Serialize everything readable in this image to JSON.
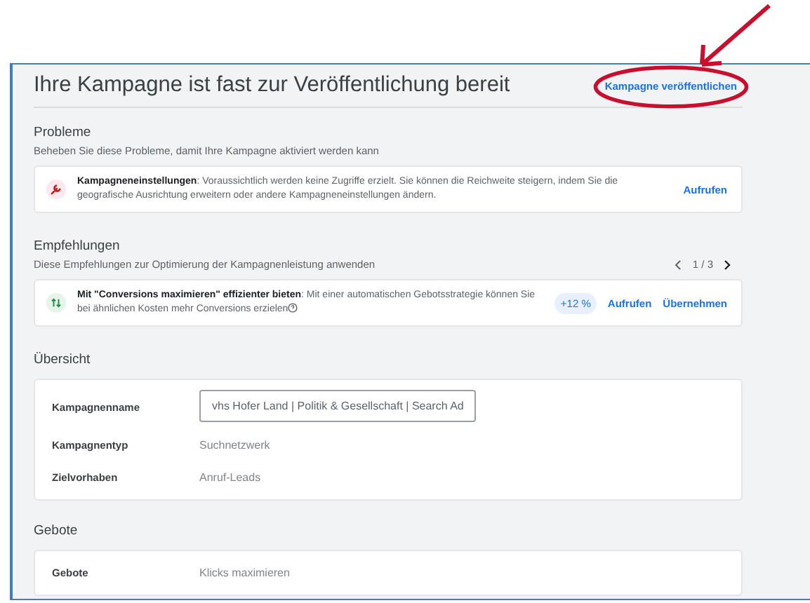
{
  "header": {
    "title": "Ihre Kampagne ist fast zur Veröffentlichung bereit",
    "publish_link": "Kampagne veröffentlichen"
  },
  "problems": {
    "title": "Probleme",
    "subtitle": "Beheben Sie diese Probleme, damit Ihre Kampagne aktiviert werden kann",
    "items": [
      {
        "text": "**Kampagneneinstellungen**: Voraussichtlich werden keine Zugriffe erzielt. Sie können die Reichweite steigern, indem Sie die geografische Ausrichtung erweitern oder andere Kampagneneinstellungen ändern.",
        "action": "Aufrufen"
      }
    ]
  },
  "recommendations": {
    "title": "Empfehlungen",
    "subtitle": "Diese Empfehlungen zur Optimierung der Kampagnenleistung anwenden",
    "pager": "1 / 3",
    "items": [
      {
        "text": "**Mit \"Conversions maximieren\" effizienter bieten**: Mit einer automatischen Gebotsstrategie können Sie bei ähnlichen Kosten mehr Conversions erzielen",
        "badge": "+12 %",
        "actions": [
          "Aufrufen",
          "Übernehmen"
        ]
      }
    ]
  },
  "overview": {
    "title": "Übersicht",
    "rows": [
      {
        "kind": "input",
        "label": "Kampagnenname",
        "value": "vhs Hofer Land | Politik & Gesellschaft | Search Ad"
      },
      {
        "kind": "text",
        "label": "Kampagnentyp",
        "value": "Suchnetzwerk"
      },
      {
        "kind": "text",
        "label": "Zielvorhaben",
        "value": "Anruf-Leads"
      }
    ]
  },
  "bids": {
    "title": "Gebote",
    "rows": [
      {
        "kind": "text",
        "label": "Gebote",
        "value": "Klicks maximieren"
      }
    ]
  }
}
